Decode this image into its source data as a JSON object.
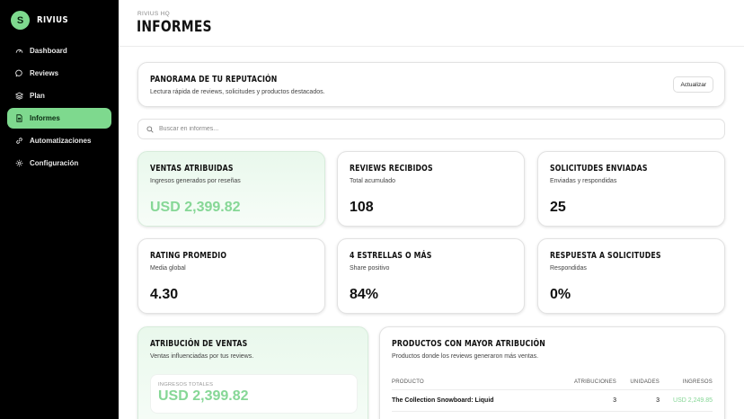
{
  "brand": {
    "logo_letter": "S",
    "name": "RIVIUS"
  },
  "sidebar": {
    "items": [
      {
        "label": "Dashboard",
        "icon": "gauge-icon",
        "active": false
      },
      {
        "label": "Reviews",
        "icon": "chat-bubble-icon",
        "active": false
      },
      {
        "label": "Plan",
        "icon": "layers-icon",
        "active": false
      },
      {
        "label": "Informes",
        "icon": "document-icon",
        "active": true
      },
      {
        "label": "Automatizaciones",
        "icon": "link-icon",
        "active": false
      },
      {
        "label": "Configuración",
        "icon": "gear-icon",
        "active": false
      }
    ]
  },
  "header": {
    "breadcrumb": "RIVIUS HQ",
    "title": "INFORMES"
  },
  "overview": {
    "title": "PANORAMA DE TU REPUTACIÓN",
    "subtitle": "Lectura rápida de reviews, solicitudes y productos destacados.",
    "refresh_label": "Actualizar"
  },
  "search": {
    "placeholder": "Buscar en informes...",
    "value": ""
  },
  "stats": [
    {
      "title": "VENTAS ATRIBUIDAS",
      "subtitle": "Ingresos generados por reseñas",
      "value": "USD 2,399.82",
      "highlight": true
    },
    {
      "title": "REVIEWS RECIBIDOS",
      "subtitle": "Total acumulado",
      "value": "108",
      "highlight": false
    },
    {
      "title": "SOLICITUDES ENVIADAS",
      "subtitle": "Enviadas y respondidas",
      "value": "25",
      "highlight": false
    },
    {
      "title": "RATING PROMEDIO",
      "subtitle": "Media global",
      "value": "4.30",
      "highlight": false
    },
    {
      "title": "4 ESTRELLAS O MÁS",
      "subtitle": "Share positivo",
      "value": "84%",
      "highlight": false
    },
    {
      "title": "RESPUESTA A SOLICITUDES",
      "subtitle": "Respondidas",
      "value": "0%",
      "highlight": false
    }
  ],
  "attribution": {
    "title": "ATRIBUCIÓN DE VENTAS",
    "subtitle": "Ventas influenciadas por tus reviews.",
    "totals_label": "INGRESOS TOTALES",
    "totals_value": "USD 2,399.82"
  },
  "products": {
    "title": "PRODUCTOS CON MAYOR ATRIBUCIÓN",
    "subtitle": "Productos donde los reviews generaron más ventas.",
    "columns": [
      "PRODUCTO",
      "ATRIBUCIONES",
      "UNIDADES",
      "INGRESOS"
    ],
    "rows": [
      {
        "product": "The Collection Snowboard: Liquid",
        "attributions": "3",
        "units": "3",
        "revenue": "USD 2,249.85"
      }
    ]
  },
  "colors": {
    "accent": "#7ed98e",
    "accent_text": "#86d796",
    "sidebar_bg": "#000000"
  }
}
